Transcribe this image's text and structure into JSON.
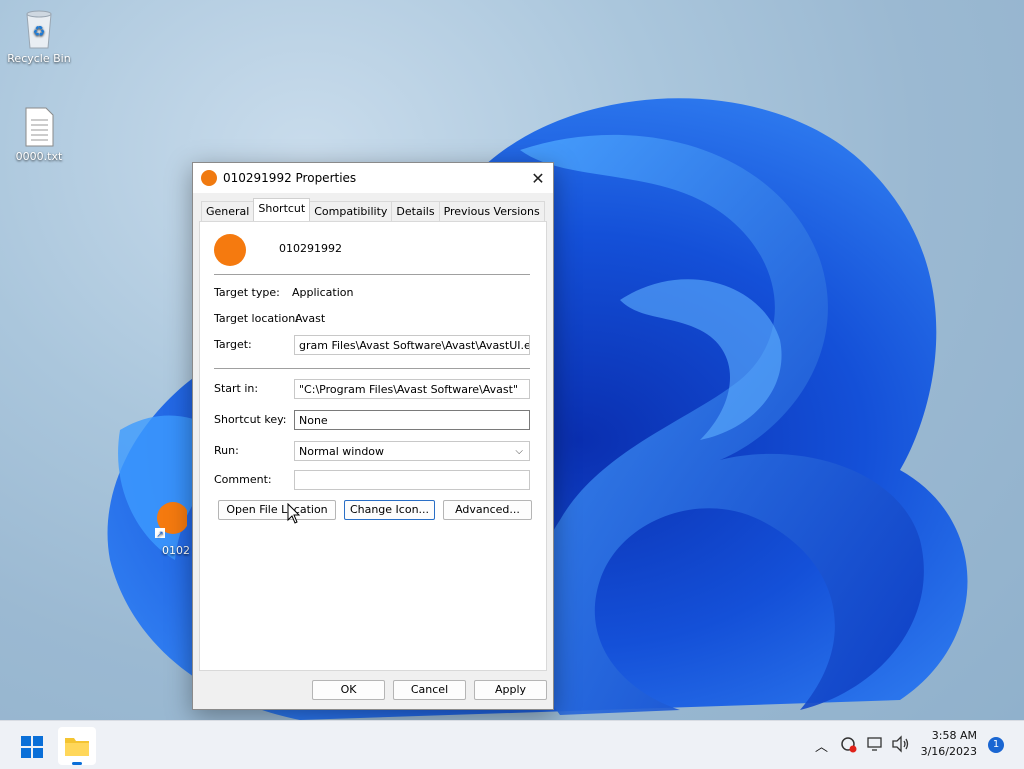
{
  "desktop": {
    "icons": [
      {
        "label": "Recycle Bin",
        "icon": "recycle-bin-icon"
      },
      {
        "label": "0000.txt",
        "icon": "text-file-icon"
      },
      {
        "label": "0102",
        "icon": "avast-shortcut-icon"
      }
    ]
  },
  "dialog": {
    "title": "010291992 Properties",
    "tabs": [
      "General",
      "Shortcut",
      "Compatibility",
      "Details",
      "Previous Versions"
    ],
    "active_tab": "Shortcut",
    "name": "010291992",
    "target_type_label": "Target type:",
    "target_type_value": "Application",
    "target_location_label": "Target location:",
    "target_location_value": "Avast",
    "target_label": "Target:",
    "target_value": "gram Files\\Avast Software\\Avast\\AvastUI.exe\"",
    "start_in_label": "Start in:",
    "start_in_value": "\"C:\\Program Files\\Avast Software\\Avast\"",
    "shortcut_key_label": "Shortcut key:",
    "shortcut_key_value": "None",
    "run_label": "Run:",
    "run_value": "Normal window",
    "comment_label": "Comment:",
    "comment_value": "",
    "open_file_location": "Open File Location",
    "change_icon": "Change Icon...",
    "advanced": "Advanced...",
    "ok": "OK",
    "cancel": "Cancel",
    "apply": "Apply",
    "accent_color": "#f57a0f"
  },
  "taskbar": {
    "time": "3:58 AM",
    "date": "3/16/2023",
    "notification_count": "1"
  }
}
